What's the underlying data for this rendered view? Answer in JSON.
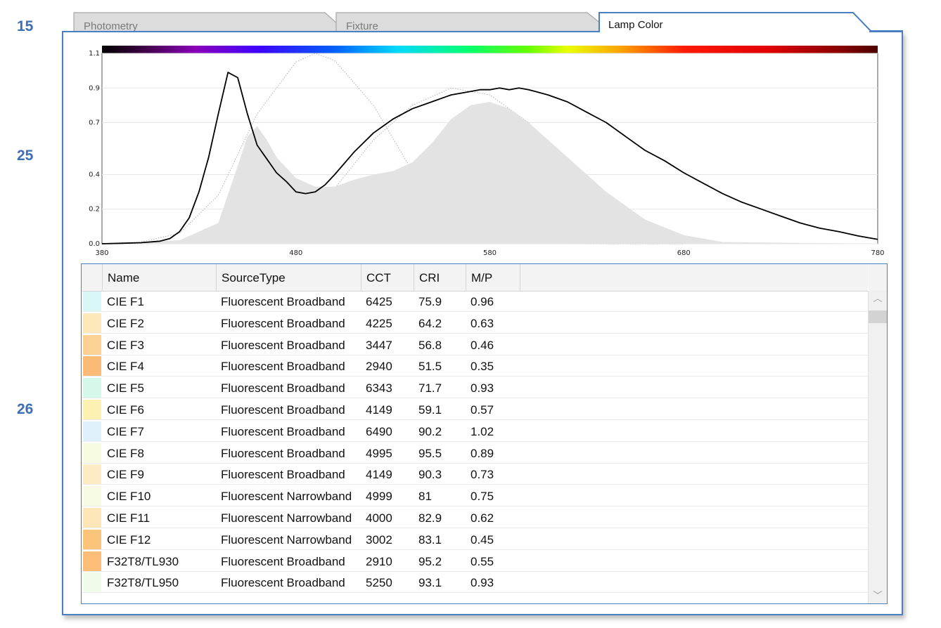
{
  "callouts": [
    "15",
    "25",
    "26"
  ],
  "tabs": [
    {
      "label": "Photometry",
      "active": false
    },
    {
      "label": "Fixture",
      "active": false
    },
    {
      "label": "Lamp Color",
      "active": true
    }
  ],
  "colors": {
    "accent": "#4b7fc4",
    "callout": "#3d6fb6",
    "curve": "#000000",
    "fill": "#e0e0e0"
  },
  "chart_data": {
    "type": "area",
    "xlim": [
      380,
      780
    ],
    "ylim": [
      0,
      1.1
    ],
    "x_ticks": [
      "380",
      "480",
      "580",
      "680",
      "780"
    ],
    "y_ticks": [
      "0.0",
      "0.2",
      "0.4",
      "0.7",
      "0.9",
      "1.1"
    ],
    "grid": true,
    "spectrum_bar": true,
    "series": [
      {
        "style": "line",
        "x": [
          380,
          390,
          400,
          410,
          415,
          420,
          425,
          430,
          435,
          440,
          445,
          450,
          455,
          460,
          465,
          470,
          475,
          480,
          485,
          490,
          495,
          500,
          510,
          520,
          530,
          540,
          550,
          560,
          570,
          575,
          580,
          585,
          590,
          595,
          600,
          610,
          620,
          630,
          640,
          650,
          660,
          670,
          680,
          690,
          700,
          710,
          720,
          730,
          740,
          750,
          760,
          770,
          780
        ],
        "y": [
          0.0,
          0.003,
          0.006,
          0.015,
          0.03,
          0.07,
          0.15,
          0.3,
          0.5,
          0.75,
          0.99,
          0.96,
          0.75,
          0.57,
          0.49,
          0.41,
          0.36,
          0.3,
          0.29,
          0.3,
          0.34,
          0.4,
          0.53,
          0.64,
          0.72,
          0.78,
          0.82,
          0.86,
          0.88,
          0.89,
          0.89,
          0.9,
          0.89,
          0.9,
          0.89,
          0.86,
          0.82,
          0.76,
          0.7,
          0.62,
          0.54,
          0.48,
          0.41,
          0.35,
          0.29,
          0.24,
          0.2,
          0.16,
          0.12,
          0.09,
          0.07,
          0.045,
          0.025
        ]
      },
      {
        "style": "dotted",
        "x": [
          380,
          400,
          420,
          440,
          460,
          480,
          490,
          500,
          520,
          540,
          560,
          580,
          600,
          620,
          640,
          660,
          680
        ],
        "y": [
          0,
          0.01,
          0.06,
          0.28,
          0.75,
          1.05,
          1.1,
          1.06,
          0.8,
          0.42,
          0.14,
          0.03,
          0.008,
          0.002,
          0,
          0,
          0
        ]
      },
      {
        "style": "dotted",
        "x": [
          380,
          420,
          460,
          500,
          520,
          540,
          560,
          580,
          600,
          620,
          640,
          660,
          680,
          700
        ],
        "y": [
          0,
          0.003,
          0.06,
          0.32,
          0.6,
          0.8,
          0.9,
          0.86,
          0.7,
          0.43,
          0.22,
          0.08,
          0.025,
          0.005
        ]
      },
      {
        "style": "fill",
        "x": [
          380,
          420,
          440,
          450,
          455,
          460,
          465,
          470,
          480,
          490,
          500,
          510,
          520,
          530,
          540,
          550,
          560,
          570,
          580,
          590,
          600,
          620,
          640,
          660,
          680,
          700,
          780
        ],
        "y": [
          0,
          0.02,
          0.12,
          0.45,
          0.62,
          0.68,
          0.6,
          0.5,
          0.38,
          0.33,
          0.33,
          0.37,
          0.4,
          0.42,
          0.47,
          0.58,
          0.72,
          0.8,
          0.82,
          0.78,
          0.7,
          0.5,
          0.3,
          0.14,
          0.05,
          0.01,
          0
        ]
      }
    ]
  },
  "table": {
    "columns": [
      "Name",
      "SourceType",
      "CCT",
      "CRI",
      "M/P"
    ],
    "rows": [
      {
        "swatch": "#d9f7f7",
        "name": "CIE F1",
        "type": "Fluorescent Broadband",
        "cct": "6425",
        "cri": "75.9",
        "mp": "0.96"
      },
      {
        "swatch": "#fde8bc",
        "name": "CIE F2",
        "type": "Fluorescent Broadband",
        "cct": "4225",
        "cri": "64.2",
        "mp": "0.63"
      },
      {
        "swatch": "#fdd093",
        "name": "CIE F3",
        "type": "Fluorescent Broadband",
        "cct": "3447",
        "cri": "56.8",
        "mp": "0.46"
      },
      {
        "swatch": "#fbbb76",
        "name": "CIE F4",
        "type": "Fluorescent Broadband",
        "cct": "2940",
        "cri": "51.5",
        "mp": "0.35"
      },
      {
        "swatch": "#d6f8ea",
        "name": "CIE F5",
        "type": "Fluorescent Broadband",
        "cct": "6343",
        "cri": "71.7",
        "mp": "0.93"
      },
      {
        "swatch": "#fdf0b3",
        "name": "CIE F6",
        "type": "Fluorescent Broadband",
        "cct": "4149",
        "cri": "59.1",
        "mp": "0.57"
      },
      {
        "swatch": "#dff2fb",
        "name": "CIE F7",
        "type": "Fluorescent Broadband",
        "cct": "6490",
        "cri": "90.2",
        "mp": "1.02"
      },
      {
        "swatch": "#f7fbe2",
        "name": "CIE F8",
        "type": "Fluorescent Broadband",
        "cct": "4995",
        "cri": "95.5",
        "mp": "0.89"
      },
      {
        "swatch": "#fdebc6",
        "name": "CIE F9",
        "type": "Fluorescent Broadband",
        "cct": "4149",
        "cri": "90.3",
        "mp": "0.73"
      },
      {
        "swatch": "#f8fbe3",
        "name": "CIE F10",
        "type": "Fluorescent Narrowband",
        "cct": "4999",
        "cri": "81",
        "mp": "0.75"
      },
      {
        "swatch": "#fde6b8",
        "name": "CIE F11",
        "type": "Fluorescent Narrowband",
        "cct": "4000",
        "cri": "82.9",
        "mp": "0.62"
      },
      {
        "swatch": "#fbc47b",
        "name": "CIE F12",
        "type": "Fluorescent Narrowband",
        "cct": "3002",
        "cri": "83.1",
        "mp": "0.45"
      },
      {
        "swatch": "#fbbd78",
        "name": "F32T8/TL930",
        "type": "Fluorescent Broadband",
        "cct": "2910",
        "cri": "95.2",
        "mp": "0.55"
      },
      {
        "swatch": "#f1fbe9",
        "name": "F32T8/TL950",
        "type": "Fluorescent Broadband",
        "cct": "5250",
        "cri": "93.1",
        "mp": "0.93"
      }
    ]
  }
}
